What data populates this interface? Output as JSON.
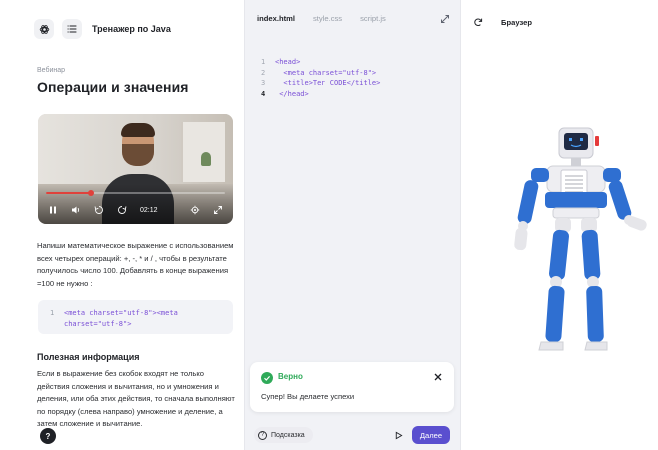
{
  "header": {
    "app_title": "Тренажер по Java"
  },
  "lesson": {
    "overline": "Вебинар",
    "title": "Операции и значения"
  },
  "video": {
    "time": "02:12",
    "progress": 0.25
  },
  "task": {
    "text": "Напиши математическое выражение с использованием всех четырех операций: +, -, * и / , чтобы в результате получилось число 100. Добавлять в конце выражения =100 не нужно :",
    "code_line_number": "1",
    "code": "<meta charset=\"utf-8\"><meta charset=\"utf-8\">"
  },
  "info": {
    "title": "Полезная информация",
    "text": "Если в выражение без скобок входят не только действия сложения и вычитания, но и умножения и деления, или оба этих действия, то сначала выполняют по порядку (слева направо) умножение и деление, а затем сложение и вычитание."
  },
  "editor": {
    "tabs": [
      "index.html",
      "style.css",
      "script.js"
    ],
    "active_tab": "index.html",
    "lines": [
      {
        "n": "1",
        "code": "<head>"
      },
      {
        "n": "2",
        "code": "  <meta charset=\"utf-8\">"
      },
      {
        "n": "3",
        "code": "  <title>Тег CODE</title>"
      },
      {
        "n": "4",
        "code": " </head>"
      }
    ],
    "current_line": "4"
  },
  "toast": {
    "title": "Верно",
    "message": "Супер! Вы делаете успехи"
  },
  "actions": {
    "hint_label": "Подсказка",
    "next_label": "Далее"
  },
  "browser": {
    "title": "Браузер"
  },
  "help": {
    "label": "?"
  },
  "colors": {
    "accent": "#5a4fcf",
    "success": "#2faa59",
    "code_tag": "#7a4fd6",
    "robot_blue": "#2f6fd1"
  }
}
